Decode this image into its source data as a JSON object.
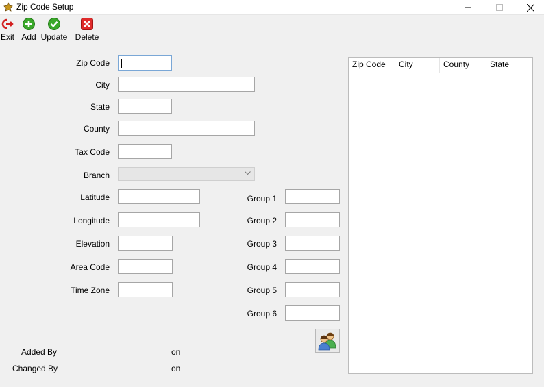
{
  "window": {
    "title": "Zip Code Setup"
  },
  "toolbar": {
    "exit_label": "Exit",
    "add_label": "Add",
    "update_label": "Update",
    "delete_label": "Delete"
  },
  "form": {
    "zip_code_label": "Zip Code",
    "city_label": "City",
    "state_label": "State",
    "county_label": "County",
    "tax_code_label": "Tax Code",
    "branch_label": "Branch",
    "latitude_label": "Latitude",
    "longitude_label": "Longitude",
    "elevation_label": "Elevation",
    "area_code_label": "Area Code",
    "time_zone_label": "Time Zone",
    "group1_label": "Group 1",
    "group2_label": "Group 2",
    "group3_label": "Group 3",
    "group4_label": "Group 4",
    "group5_label": "Group 5",
    "group6_label": "Group 6"
  },
  "audit": {
    "added_by_label": "Added By",
    "changed_by_label": "Changed By",
    "added_on_label": "on",
    "changed_on_label": "on"
  },
  "grid": {
    "columns": [
      "Zip Code",
      "City",
      "County",
      "State"
    ]
  },
  "icons": {
    "app": "gold-eagle-icon",
    "exit": "exit-door-icon",
    "add": "add-plus-icon",
    "update": "checkmark-icon",
    "delete": "delete-x-icon",
    "users": "users-icon"
  },
  "colors": {
    "add_green": "#3aa82a",
    "update_green": "#3aa82a",
    "delete_red": "#e02b2b",
    "exit_red": "#d32020",
    "focus_border": "#7aa7d6"
  }
}
